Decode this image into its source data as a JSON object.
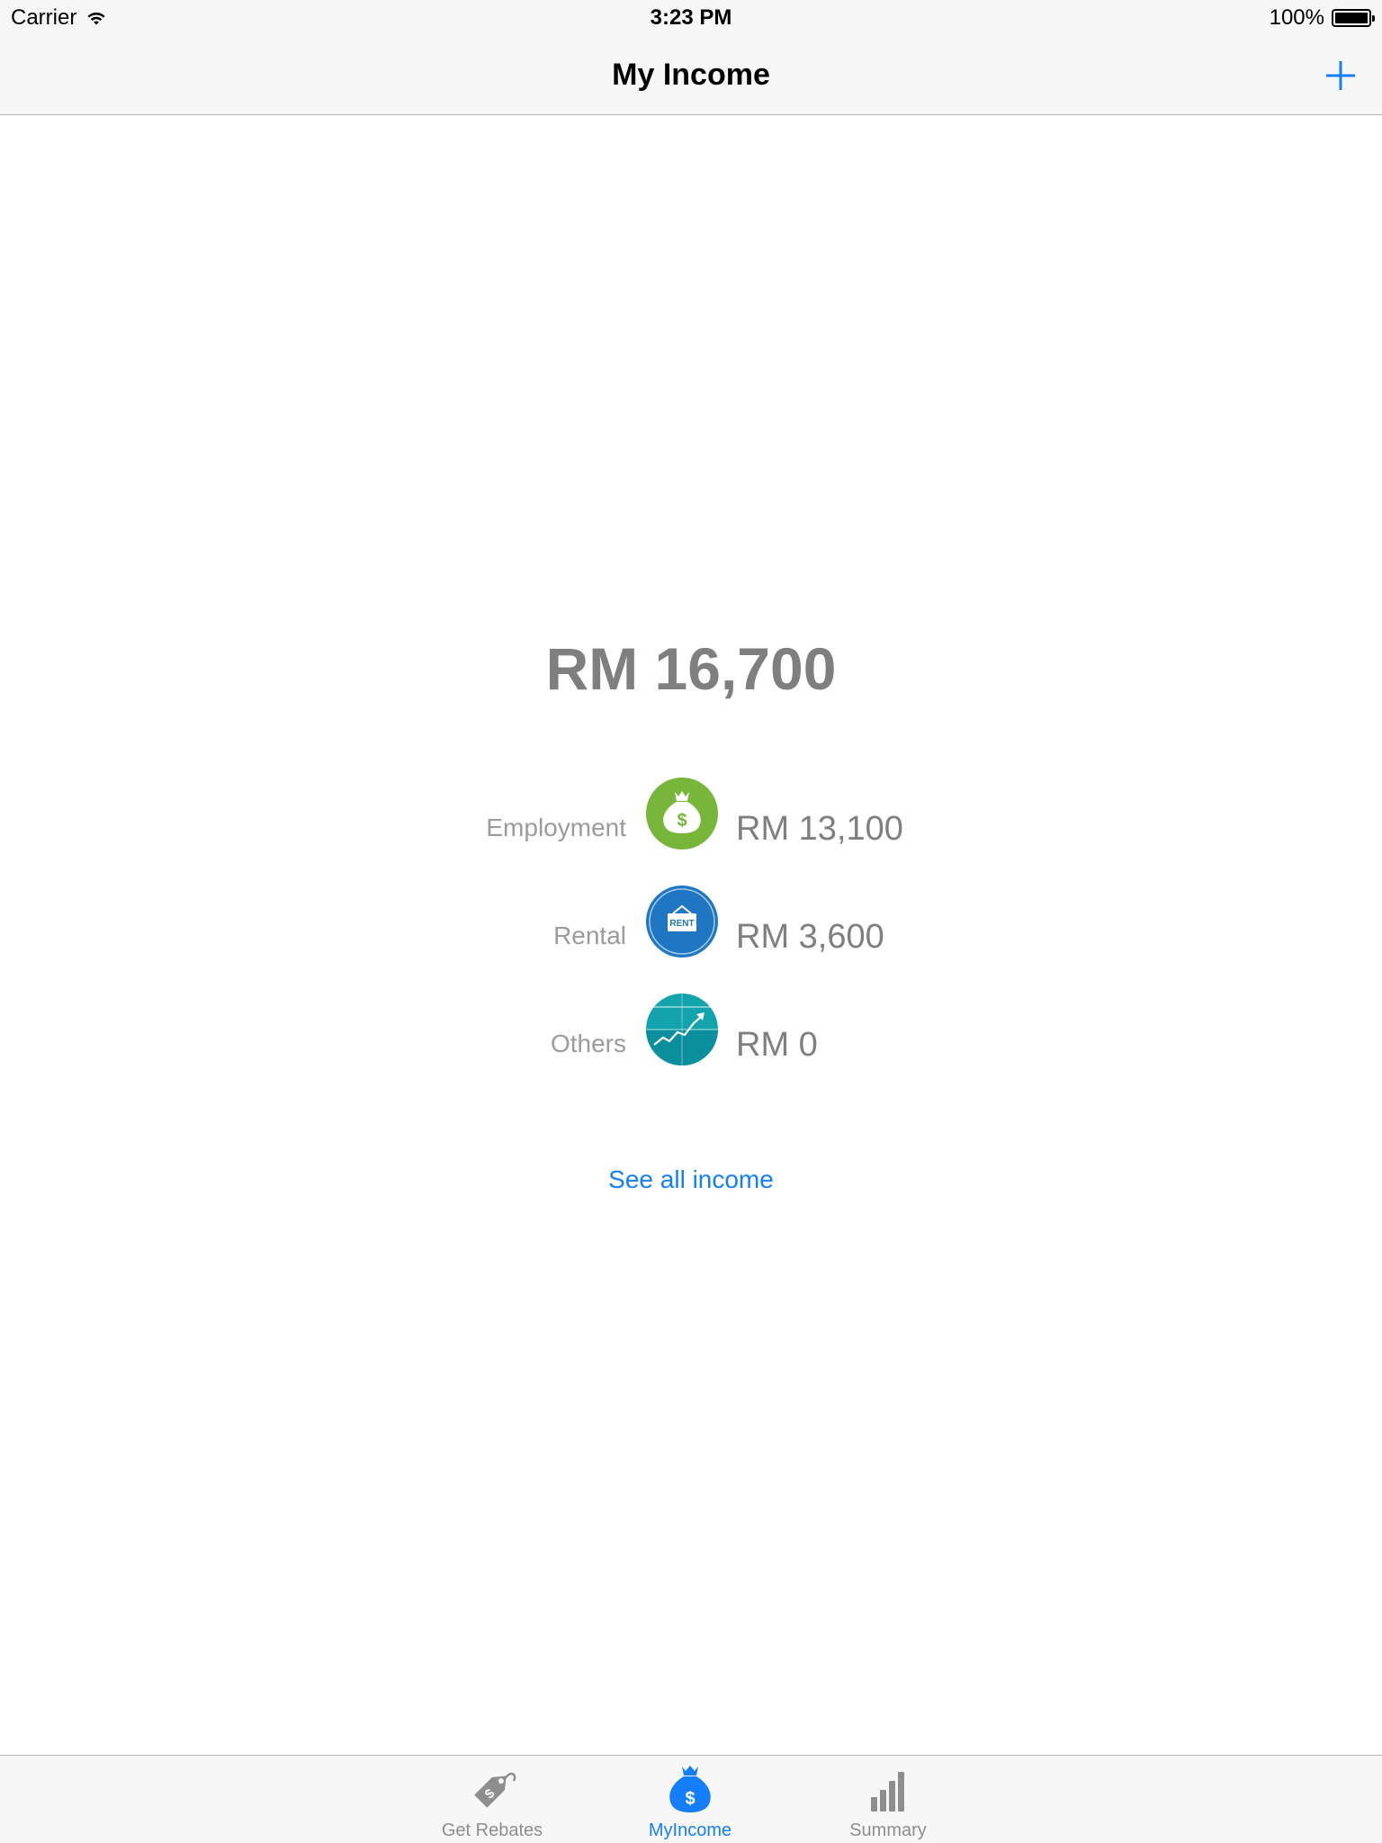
{
  "status_bar": {
    "carrier": "Carrier",
    "time": "3:23 PM",
    "battery_label": "100%",
    "battery_level": 1.0
  },
  "nav": {
    "title": "My Income",
    "add_icon": "plus-icon"
  },
  "summary": {
    "total": "RM 16,700"
  },
  "income_rows": [
    {
      "label": "Employment",
      "amount": "RM 13,100",
      "icon": "money-bag-icon",
      "color": "#78b53b"
    },
    {
      "label": "Rental",
      "amount": "RM 3,600",
      "icon": "rent-sign-icon",
      "color": "#1f76c2"
    },
    {
      "label": "Others",
      "amount": "RM 0",
      "icon": "growth-chart-icon",
      "color": "#0ea5b3"
    }
  ],
  "links": {
    "see_all": "See all income"
  },
  "tab_bar": {
    "tabs": [
      {
        "label": "Get Rebates",
        "icon": "price-tag-icon",
        "active": false
      },
      {
        "label": "MyIncome",
        "icon": "money-bag-icon",
        "active": true
      },
      {
        "label": "Summary",
        "icon": "bar-chart-icon",
        "active": false
      }
    ]
  },
  "colors": {
    "accent": "#157efb",
    "text_gray": "#7f7f7f",
    "label_gray": "#9b9b9b",
    "bar_bg": "#f7f7f7"
  }
}
